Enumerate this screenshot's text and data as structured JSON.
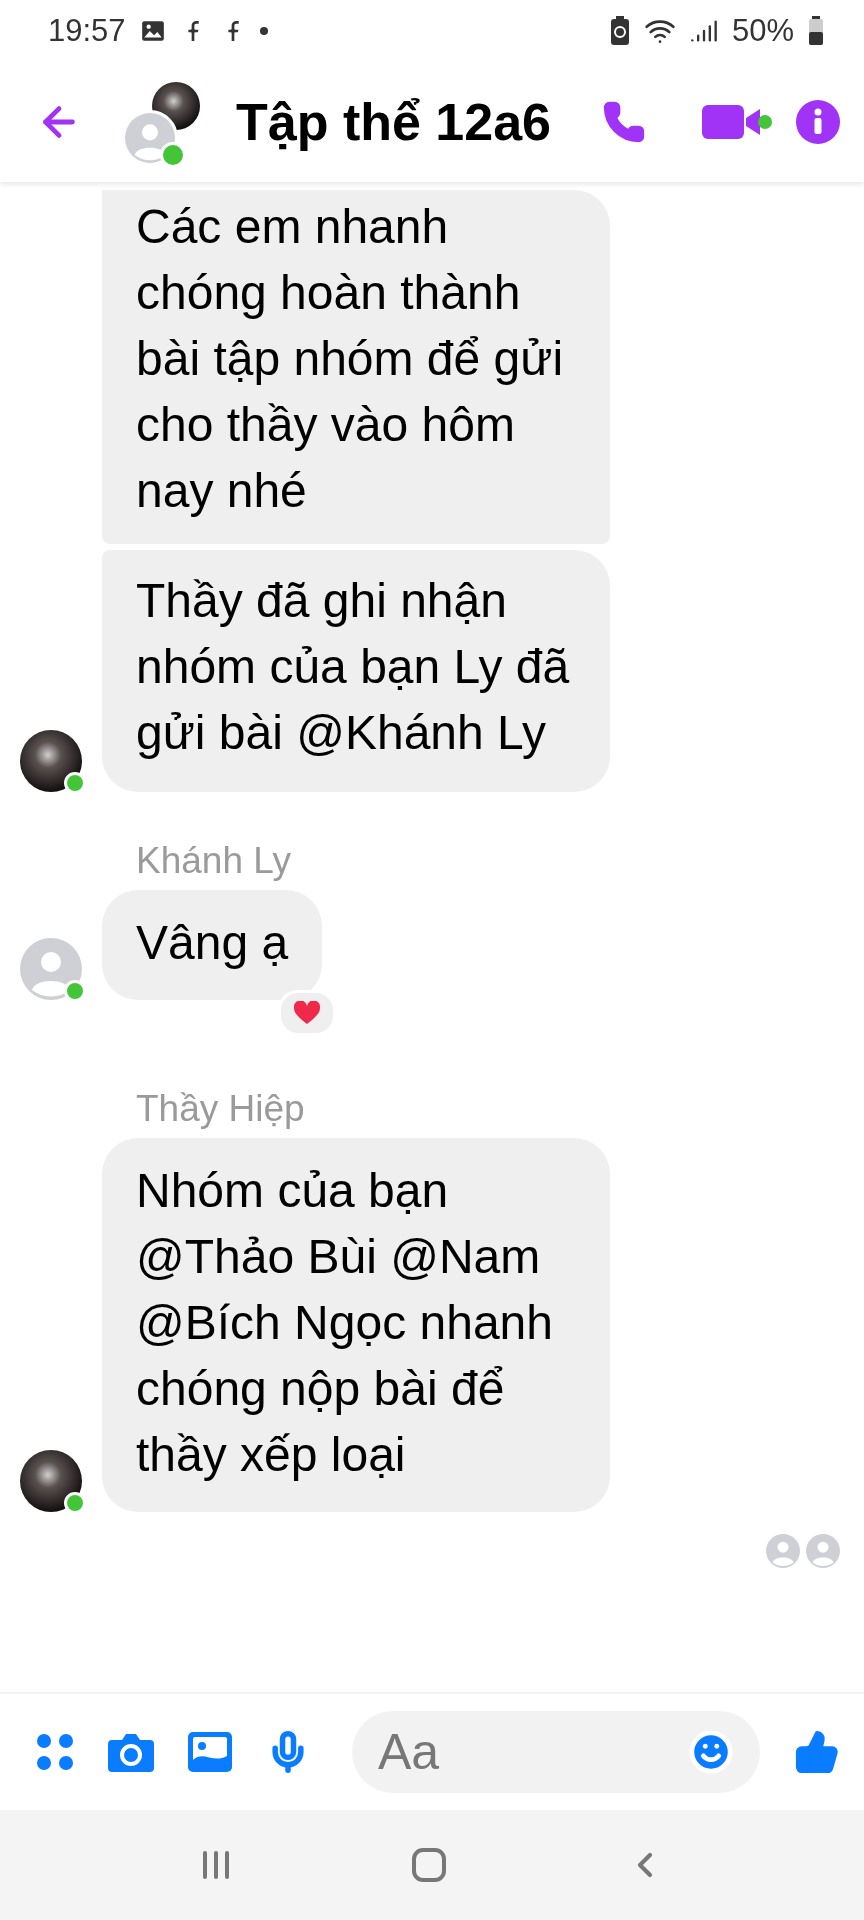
{
  "status_bar": {
    "time": "19:57",
    "battery": "50%"
  },
  "header": {
    "title": "Tập thể 12a6",
    "online": true,
    "video_online": true
  },
  "messages": [
    {
      "kind": "bubble",
      "text": "Các em nhanh chóng hoàn thành bài tập nhóm để gửi cho thầy vào hôm nay nhé"
    },
    {
      "kind": "bubble",
      "text": "Thầy đã ghi nhận nhóm của bạn Ly đã gửi bài @Khánh Ly",
      "avatar": {
        "kind": "photo",
        "online": true
      }
    },
    {
      "kind": "sender",
      "text": "Khánh Ly"
    },
    {
      "kind": "bubble",
      "text": "Vâng ạ",
      "avatar": {
        "kind": "default",
        "online": true
      },
      "reacted": true
    },
    {
      "kind": "sender",
      "text": "Thầy Hiệp"
    },
    {
      "kind": "bubble",
      "text": "Nhóm của bạn @Thảo Bùi @Nam @Bích Ngọc nhanh chóng nộp bài để thầy xếp loại",
      "avatar": {
        "kind": "photo",
        "online": true
      }
    }
  ],
  "seen_by": [
    {
      "kind": "default"
    },
    {
      "kind": "default"
    }
  ],
  "composer": {
    "placeholder": "Aa"
  }
}
